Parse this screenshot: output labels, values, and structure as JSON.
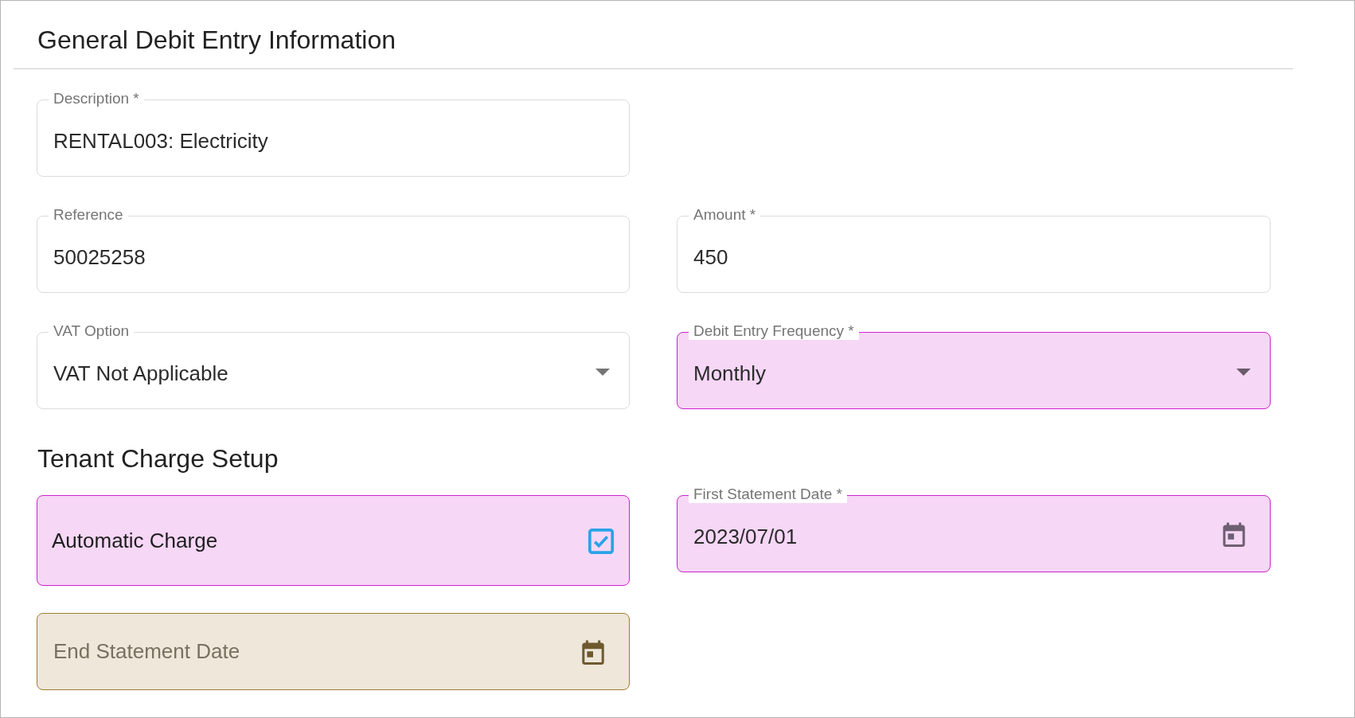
{
  "title": "General Debit Entry Information",
  "rows": [
    [
      {
        "kind": "text",
        "label": "Description *",
        "value": "RENTAL003: Electricity"
      }
    ],
    [
      {
        "kind": "text",
        "label": "Reference",
        "value": "50025258"
      },
      {
        "kind": "text",
        "label": "Amount *",
        "value": "450"
      }
    ],
    [
      {
        "kind": "select",
        "label": "VAT Option",
        "value": "VAT Not Applicable"
      },
      {
        "kind": "select",
        "label": "Debit Entry Frequency *",
        "value": "Monthly",
        "color": "#cc22cc"
      }
    ]
  ],
  "subtitle": "Tenant Charge Setup",
  "setup_rows": [
    [
      {
        "kind": "checkbox",
        "value": "Automatic Charge",
        "checked": true,
        "color": "#cc22cc"
      },
      {
        "kind": "date",
        "label": "First Statement Date *",
        "value": "2023/07/01",
        "color": "#cc22cc"
      }
    ],
    [
      {
        "kind": "date",
        "placeholder": "End Statement Date",
        "color": "#a07c30"
      }
    ]
  ]
}
